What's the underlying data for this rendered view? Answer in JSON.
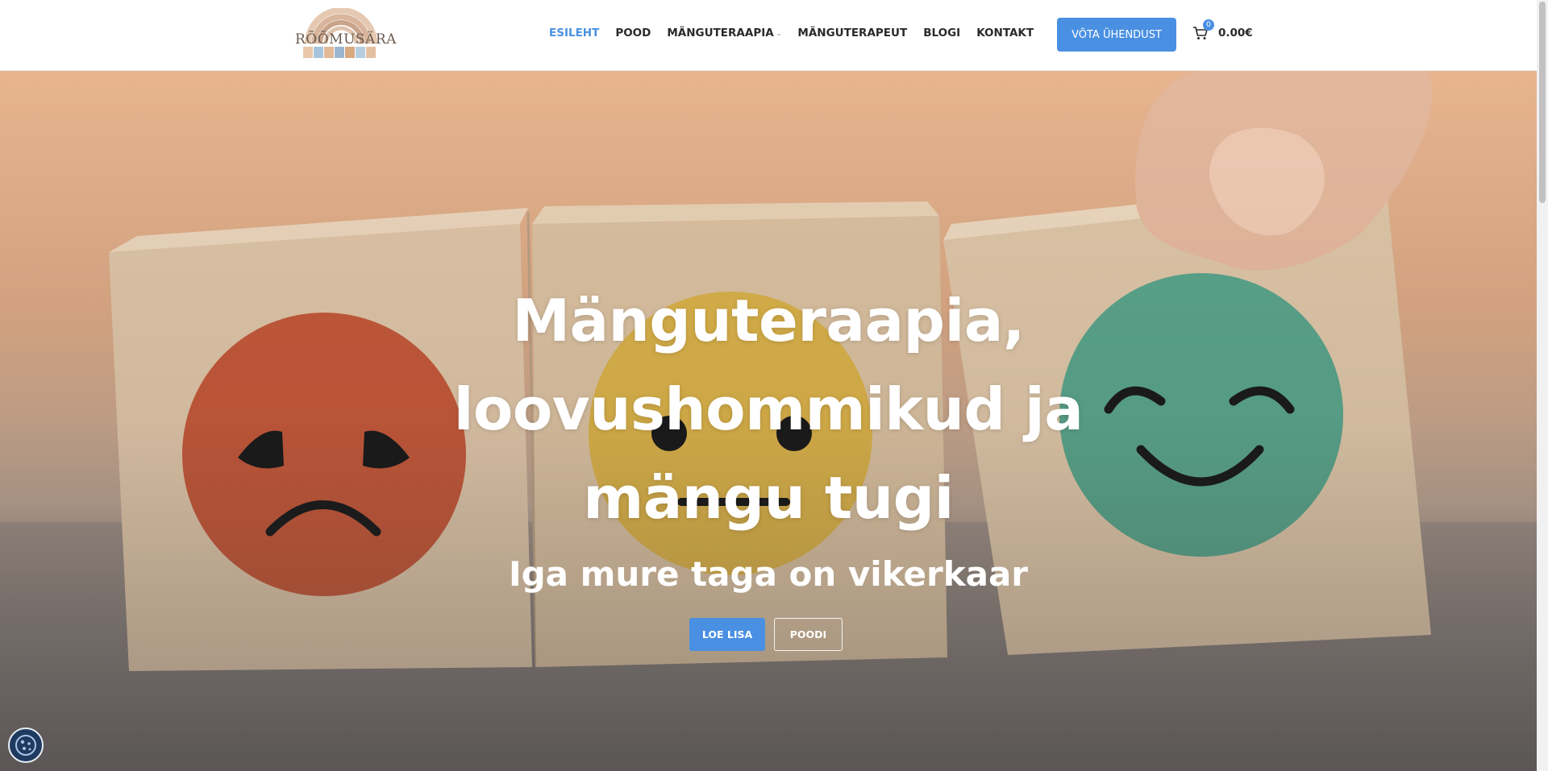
{
  "header": {
    "logo_text": "RÕÕMUSÄRA",
    "nav": [
      {
        "label": "ESILEHT",
        "active": true
      },
      {
        "label": "POOD"
      },
      {
        "label": "MÄNGUTERAAPIA",
        "has_dropdown": true
      },
      {
        "label": "MÄNGUTERAPEUT"
      },
      {
        "label": "BLOGI"
      },
      {
        "label": "KONTAKT"
      }
    ],
    "contact_button": "VÕTA ÜHENDUST",
    "cart": {
      "count": "0",
      "total": "0.00€"
    }
  },
  "hero": {
    "title_lines": [
      "Mänguteraapia,",
      "loovushommikud ja",
      "mängu tugi"
    ],
    "subtitle": "Iga mure taga on vikerkaar",
    "primary_button": "LOE LISA",
    "secondary_button": "POODI"
  },
  "colors": {
    "accent": "#4a90e2",
    "text": "#2a2a2a",
    "sad_face": "#c2583a",
    "neutral_face": "#d8b04a",
    "happy_face": "#5aa38a"
  },
  "icons": {
    "cart": "cart-icon",
    "cookie": "cookie-icon",
    "dropdown": "chevron-down-icon"
  }
}
